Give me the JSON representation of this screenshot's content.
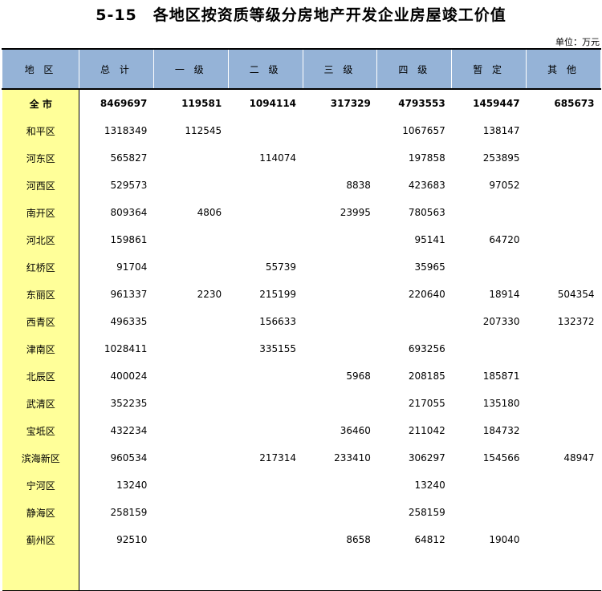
{
  "title": "5-15　各地区按资质等级分房地产开发企业房屋竣工价值",
  "unit": "单位：万元",
  "headers": [
    "地 区",
    "总 计",
    "一 级",
    "二 级",
    "三 级",
    "四 级",
    "暂 定",
    "其 他"
  ],
  "rows": [
    [
      "全 市",
      "8469697",
      "119581",
      "1094114",
      "317329",
      "4793553",
      "1459447",
      "685673"
    ],
    [
      "和平区",
      "1318349",
      "112545",
      "",
      "",
      "1067657",
      "138147",
      ""
    ],
    [
      "河东区",
      "565827",
      "",
      "114074",
      "",
      "197858",
      "253895",
      ""
    ],
    [
      "河西区",
      "529573",
      "",
      "",
      "8838",
      "423683",
      "97052",
      ""
    ],
    [
      "南开区",
      "809364",
      "4806",
      "",
      "23995",
      "780563",
      "",
      ""
    ],
    [
      "河北区",
      "159861",
      "",
      "",
      "",
      "95141",
      "64720",
      ""
    ],
    [
      "红桥区",
      "91704",
      "",
      "55739",
      "",
      "35965",
      "",
      ""
    ],
    [
      "东丽区",
      "961337",
      "2230",
      "215199",
      "",
      "220640",
      "18914",
      "504354"
    ],
    [
      "西青区",
      "496335",
      "",
      "156633",
      "",
      "",
      "207330",
      "132372"
    ],
    [
      "津南区",
      "1028411",
      "",
      "335155",
      "",
      "693256",
      "",
      ""
    ],
    [
      "北辰区",
      "400024",
      "",
      "",
      "5968",
      "208185",
      "185871",
      ""
    ],
    [
      "武清区",
      "352235",
      "",
      "",
      "",
      "217055",
      "135180",
      ""
    ],
    [
      "宝坻区",
      "432234",
      "",
      "",
      "36460",
      "211042",
      "184732",
      ""
    ],
    [
      "滨海新区",
      "960534",
      "",
      "217314",
      "233410",
      "306297",
      "154566",
      "48947"
    ],
    [
      "宁河区",
      "13240",
      "",
      "",
      "",
      "13240",
      "",
      ""
    ],
    [
      "静海区",
      "258159",
      "",
      "",
      "",
      "258159",
      "",
      ""
    ],
    [
      "蓟州区",
      "92510",
      "",
      "",
      "8658",
      "64812",
      "19040",
      ""
    ]
  ]
}
